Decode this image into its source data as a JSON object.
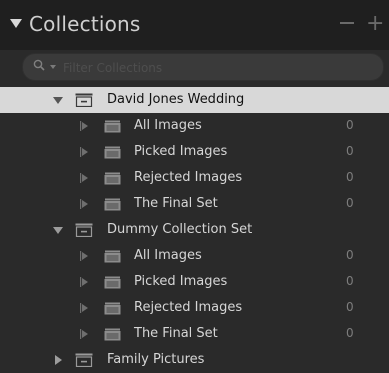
{
  "panel": {
    "title": "Collections",
    "minus_label": "−",
    "plus_label": "+"
  },
  "search": {
    "placeholder": "Filter Collections"
  },
  "sets": [
    {
      "name": "David Jones Wedding",
      "expanded": true,
      "selected": true,
      "children": [
        {
          "name": "All Images",
          "count": "0"
        },
        {
          "name": "Picked Images",
          "count": "0"
        },
        {
          "name": "Rejected Images",
          "count": "0"
        },
        {
          "name": "The Final Set",
          "count": "0"
        }
      ]
    },
    {
      "name": "Dummy Collection Set",
      "expanded": true,
      "selected": false,
      "children": [
        {
          "name": "All Images",
          "count": "0"
        },
        {
          "name": "Picked Images",
          "count": "0"
        },
        {
          "name": "Rejected Images",
          "count": "0"
        },
        {
          "name": "The Final Set",
          "count": "0"
        }
      ]
    },
    {
      "name": "Family Pictures",
      "expanded": false,
      "selected": false,
      "children": []
    }
  ],
  "colors": {
    "panel_bg": "#2a2a2a",
    "header_bg": "#1f1f1f",
    "selected_bg": "#d8d8d8",
    "text": "#d6d6d6",
    "count_text": "#7d7d7d"
  }
}
